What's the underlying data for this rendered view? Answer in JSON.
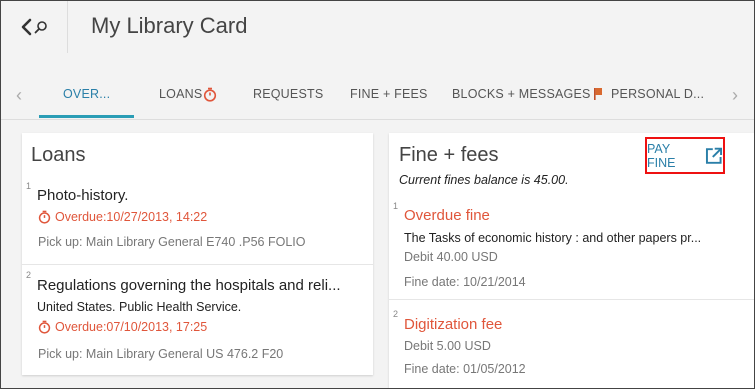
{
  "header": {
    "title": "My Library Card"
  },
  "tabs": [
    {
      "label": "OVER..."
    },
    {
      "label": "LOANS"
    },
    {
      "label": "REQUESTS"
    },
    {
      "label": "FINE + FEES"
    },
    {
      "label": "BLOCKS + MESSAGES"
    },
    {
      "label": "PERSONAL D..."
    }
  ],
  "loans": {
    "title": "Loans",
    "items": [
      {
        "num": "1",
        "title": "Photo-history.",
        "overdue": "Overdue:10/27/2013, 14:22",
        "pickup": "Pick up: Main Library General E740 .P56 FOLIO"
      },
      {
        "num": "2",
        "title": "Regulations governing the hospitals and reli...",
        "author": "United States. Public Health Service.",
        "overdue": "Overdue:07/10/2013, 17:25",
        "pickup": "Pick up: Main Library General US 476.2 F20"
      }
    ]
  },
  "fines": {
    "title": "Fine + fees",
    "pay_label": "PAY FINE",
    "balance": "Current fines balance is 45.00.",
    "items": [
      {
        "num": "1",
        "type": "Overdue fine",
        "desc": "The Tasks of economic history : and other papers pr...",
        "amount": "Debit 40.00 USD",
        "date": "Fine date: 10/21/2014"
      },
      {
        "num": "2",
        "type": "Digitization fee",
        "amount": "Debit 5.00 USD",
        "date": "Fine date: 01/05/2012"
      }
    ]
  },
  "colors": {
    "accent": "#2a7fa8",
    "overdue": "#e0563b",
    "highlight": "#ee1111"
  }
}
